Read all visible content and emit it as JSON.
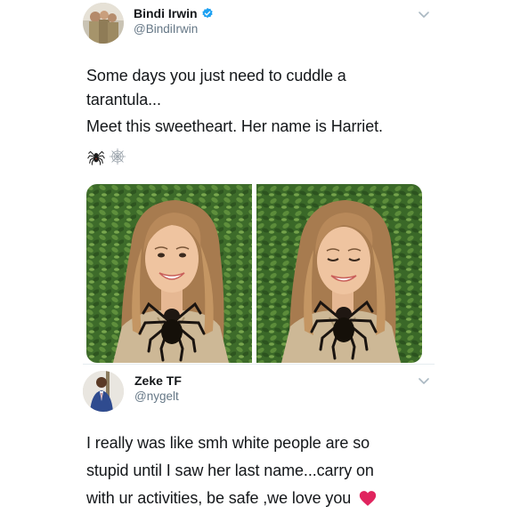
{
  "tweet1": {
    "author_name": "Bindi Irwin",
    "author_handle": "@BindiIrwin",
    "verified": true,
    "text_lines": [
      "Some days you just need to cuddle a",
      "tarantula...",
      "Meet this sweetheart. Her name is Harriet."
    ],
    "emojis": [
      "spider-icon",
      "spider-web-icon"
    ],
    "photos": [
      "photo-woman-with-tarantula-smiling",
      "photo-woman-with-tarantula-looking-down"
    ]
  },
  "tweet2": {
    "author_name": "Zeke TF",
    "author_handle": "@nygelt",
    "text_lines": [
      "I really was like smh white people are so",
      "stupid until I saw her last name...carry on",
      "with ur activities, be safe ,we love you"
    ],
    "emoji": "red-heart-icon"
  },
  "colors": {
    "text": "#14171a",
    "handle": "#657786",
    "verified": "#1da1f2",
    "heart": "#e0245e"
  }
}
